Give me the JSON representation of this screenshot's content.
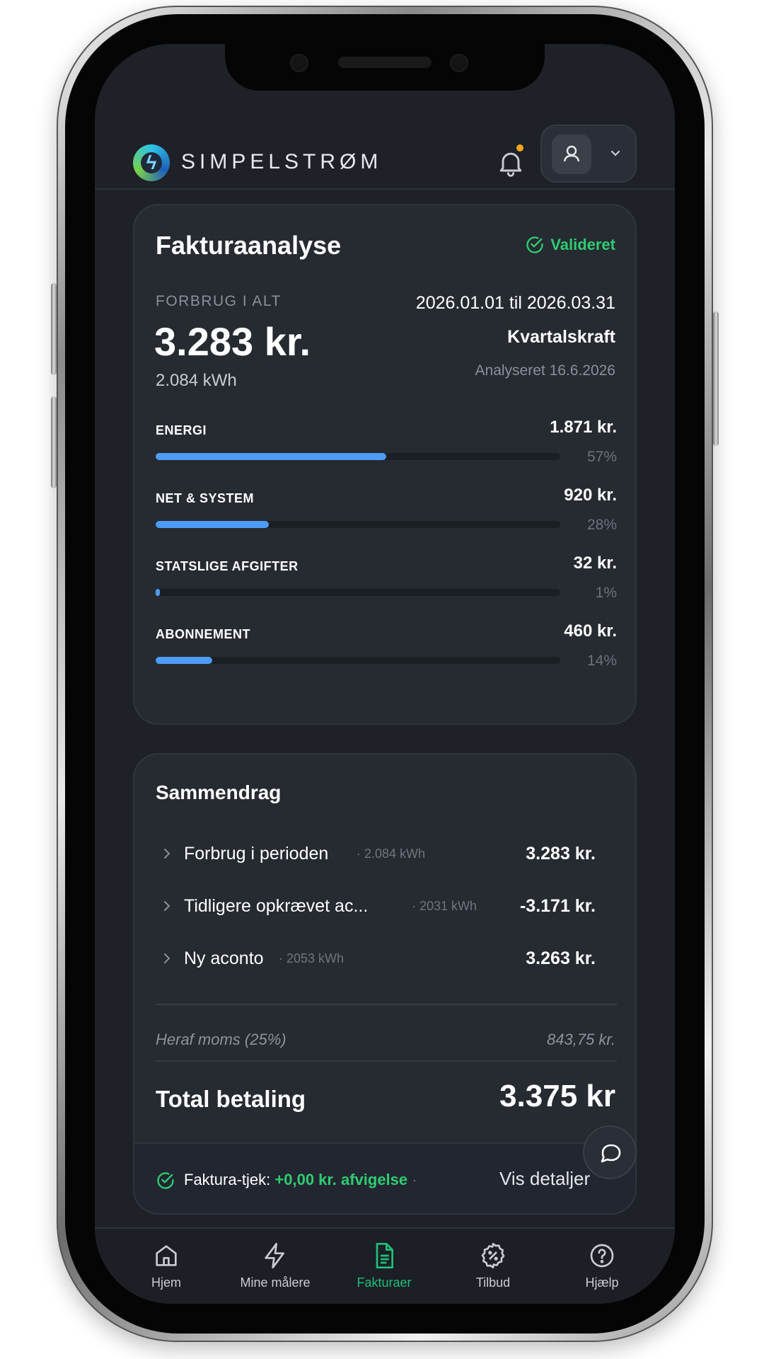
{
  "app": {
    "brand": "SIMPELSTRØM"
  },
  "analysis": {
    "title": "Fakturaanalyse",
    "status": "Valideret",
    "total_label": "FORBRUG I ALT",
    "total_amount": "3.283 kr.",
    "total_kwh": "2.084 kWh",
    "period": "2026.01.01 til 2026.03.31",
    "plan": "Kvartalskraft",
    "analysed": "Analyseret 16.6.2026",
    "categories": [
      {
        "name": "ENERGI",
        "amount": "1.871 kr.",
        "percent": "57%",
        "fraction": 0.57
      },
      {
        "name": "NET & SYSTEM",
        "amount": "920 kr.",
        "percent": "28%",
        "fraction": 0.28
      },
      {
        "name": "STATSLIGE AFGIFTER",
        "amount": "32 kr.",
        "percent": "1%",
        "fraction": 0.01
      },
      {
        "name": "ABONNEMENT",
        "amount": "460 kr.",
        "percent": "14%",
        "fraction": 0.14
      }
    ]
  },
  "summary": {
    "title": "Sammendrag",
    "rows": [
      {
        "label": "Forbrug i perioden",
        "kwh": "· 2.084 kWh",
        "amount": "3.283 kr."
      },
      {
        "label": "Tidligere opkrævet ac...",
        "kwh": "· 2031 kWh",
        "amount": "-3.171 kr."
      },
      {
        "label": "Ny aconto",
        "kwh": "· 2053 kWh",
        "amount": "3.263 kr."
      }
    ],
    "vat_label": "Heraf moms (25%)",
    "vat_amount": "843,75 kr.",
    "payment_label": "Total betaling",
    "payment_amount": "3.375 kr",
    "check_label": "Faktura-tjek:",
    "check_value": "+0,00 kr. afvigelse",
    "check_sep": "·",
    "details": "Vis detaljer"
  },
  "nav": [
    {
      "label": "Hjem",
      "icon": "home-icon"
    },
    {
      "label": "Mine målere",
      "icon": "bolt-icon"
    },
    {
      "label": "Fakturaer",
      "icon": "document-icon",
      "active": true
    },
    {
      "label": "Tilbud",
      "icon": "discount-badge-icon"
    },
    {
      "label": "Hjælp",
      "icon": "help-circle-icon"
    }
  ],
  "colors": {
    "accent_green": "#2ecc71",
    "bar_blue": "#4d9cf6",
    "background": "#1e2128"
  }
}
